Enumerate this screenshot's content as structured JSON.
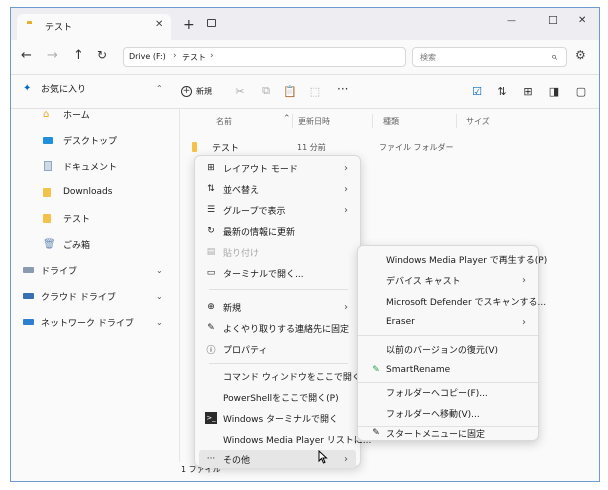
{
  "window": {
    "tab_title": "テスト",
    "tab_close": "✕",
    "new_tab": "+",
    "minimize": "—",
    "maximize": "☐",
    "close": "✕"
  },
  "address": {
    "crumbs": [
      "Drive (F:)",
      "テスト"
    ],
    "search_placeholder": "検索"
  },
  "toolbar": {
    "new_label": "新規",
    "more": "···"
  },
  "sidebar": {
    "items": [
      {
        "label": "お気に入り"
      },
      {
        "label": "ホーム"
      },
      {
        "label": "デスクトップ"
      },
      {
        "label": "ドキュメント"
      },
      {
        "label": "Downloads"
      },
      {
        "label": "テスト"
      },
      {
        "label": "ごみ箱"
      },
      {
        "label": "ドライブ"
      },
      {
        "label": "クラウド ドライブ"
      },
      {
        "label": "ネットワーク ドライブ"
      }
    ]
  },
  "columns": [
    "名前",
    "更新日時",
    "種類",
    "サイズ"
  ],
  "files": [
    {
      "name": "テスト",
      "modified": "11 分前",
      "type": "ファイル フォルダー",
      "size": ""
    }
  ],
  "status": {
    "count": "1 ファイル"
  },
  "context_menu": {
    "items": [
      {
        "label": "レイアウト モード"
      },
      {
        "label": "並べ替え"
      },
      {
        "label": "グループで表示"
      },
      {
        "label": "最新の情報に更新"
      },
      {
        "label": "貼り付け"
      },
      {
        "label": "ターミナルで開く..."
      },
      {
        "label": "新規"
      },
      {
        "label": "よくやり取りする連絡先に固定"
      },
      {
        "label": "プロパティ"
      },
      {
        "label": "コマンド ウィンドウをここで開く(W)"
      },
      {
        "label": "PowerShellをここで開く(P)"
      },
      {
        "label": "Windows ターミナルで開く"
      },
      {
        "label": "Windows Media Player リストに..."
      },
      {
        "label": "その他"
      }
    ]
  },
  "submenu": {
    "items": [
      {
        "label": "Windows Media Player で再生する(P)"
      },
      {
        "label": "デバイス キャスト"
      },
      {
        "label": "Microsoft Defender でスキャンする..."
      },
      {
        "label": "Eraser"
      },
      {
        "label": "以前のバージョンの復元(V)"
      },
      {
        "label": "SmartRename"
      },
      {
        "label": "フォルダーへコピー(F)..."
      },
      {
        "label": "フォルダーへ移動(V)..."
      },
      {
        "label": "スタートメニューに固定"
      }
    ]
  },
  "colors": {
    "accent": "#0067c0",
    "folder": "#f3c24a",
    "window_border": "#6f9ad0"
  }
}
